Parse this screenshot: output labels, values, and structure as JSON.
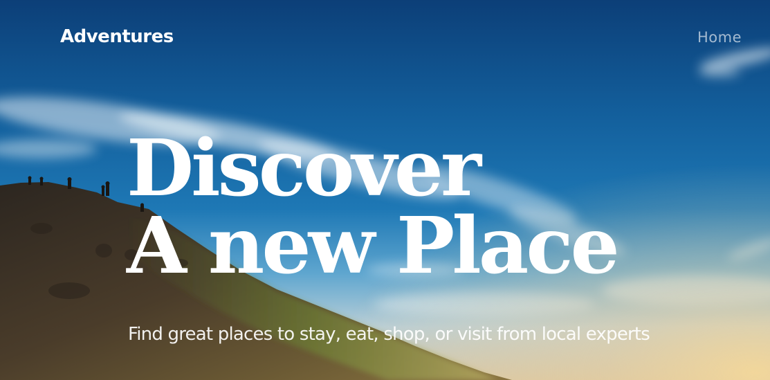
{
  "nav": {
    "brand": "Adventures",
    "home_link": "Home"
  },
  "hero": {
    "headline_line1": "Discover",
    "headline_line2": "A new Place",
    "tagline": "Find great places to stay, eat, shop, or visit from local experts",
    "background_image": "hillside-sunset-sky-photo",
    "colors": {
      "sky_top": "#0c3f78",
      "sky_mid": "#1e78b5",
      "hill": "#3a2d22",
      "text": "#ffffff"
    }
  }
}
